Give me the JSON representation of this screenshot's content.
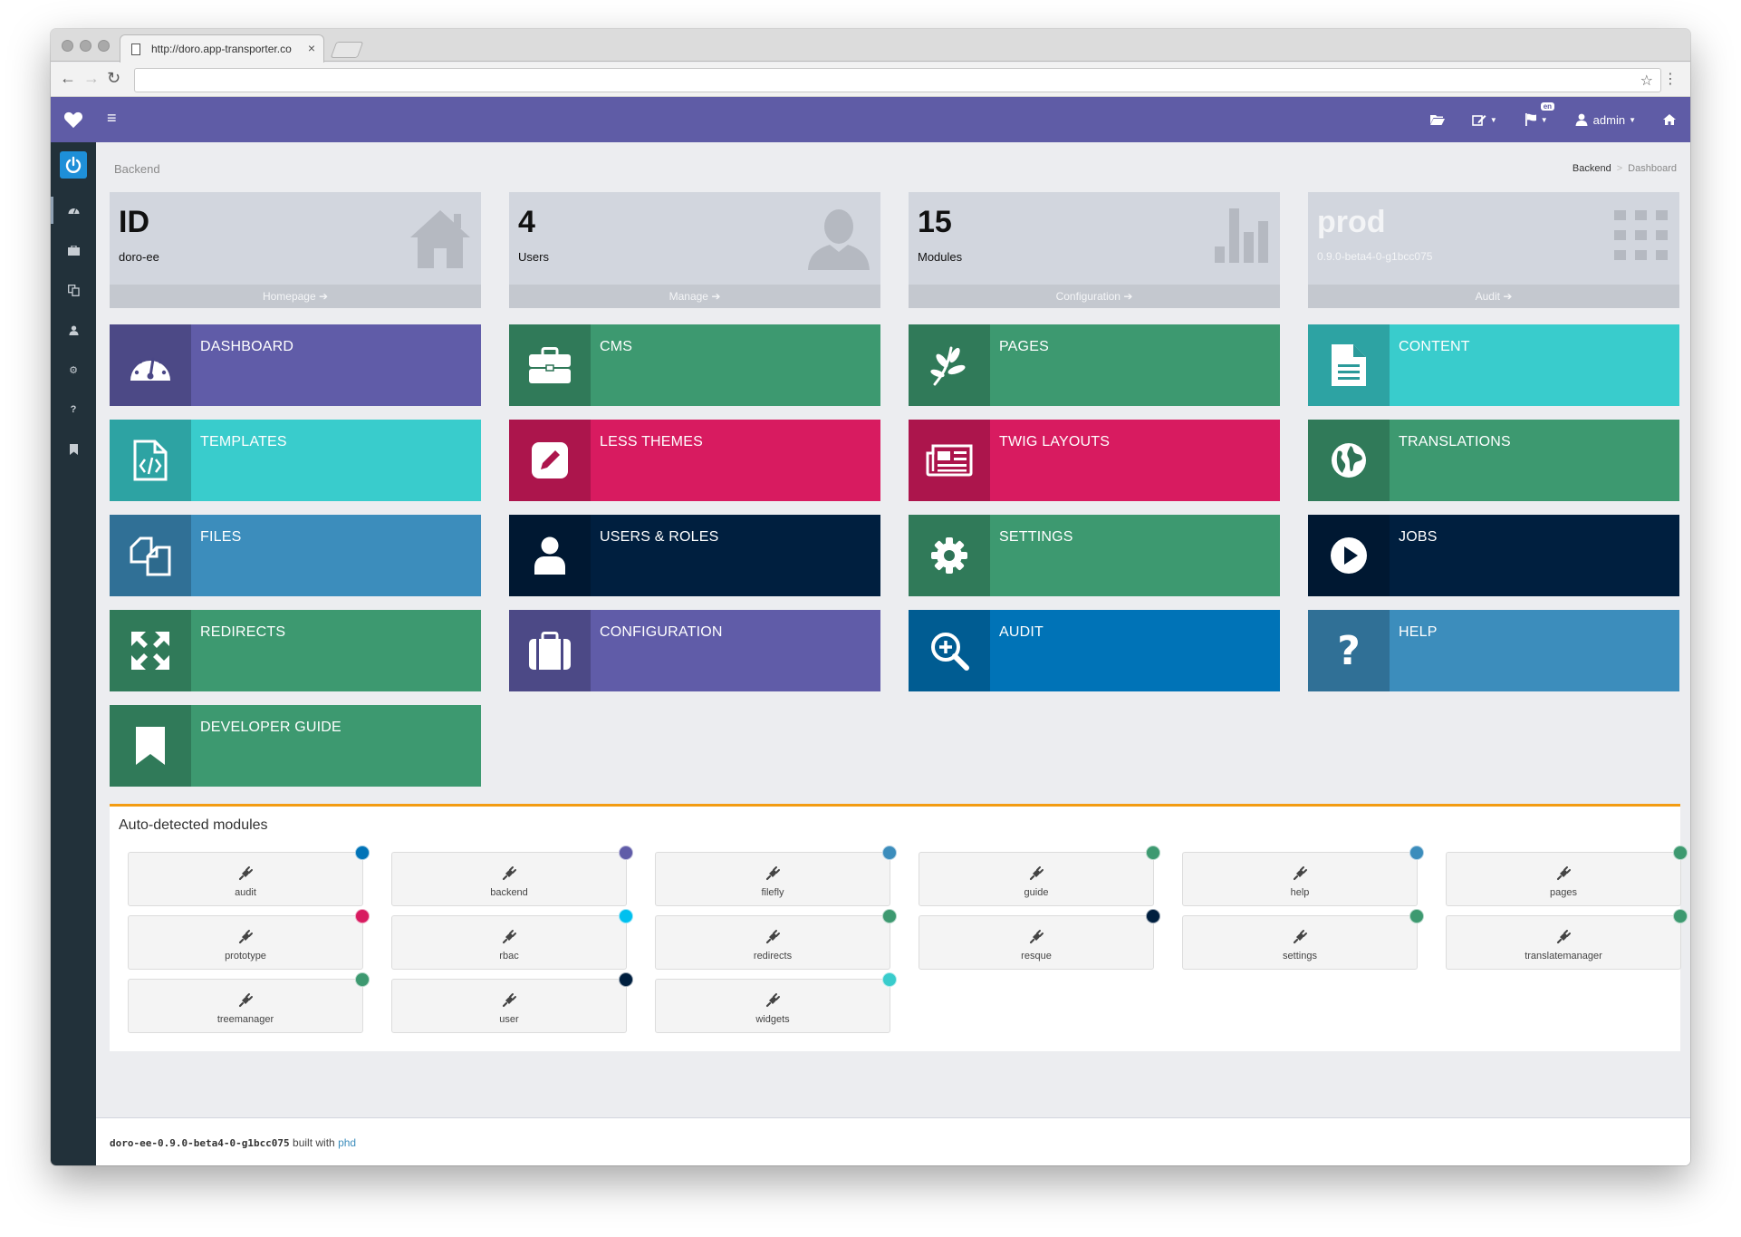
{
  "browser": {
    "tab_title": "http://doro.app-transporter.co",
    "tab_close": "×",
    "address": "",
    "back": "←",
    "forward": "→",
    "reload": "↻",
    "star": "☆",
    "menu": "⋮"
  },
  "topnav": {
    "brand_icon": "heart-icon",
    "toggle": "≡",
    "lang_badge": "en",
    "user_name": "admin",
    "caret": "▼"
  },
  "sidebar": {
    "items": [
      {
        "icon": "dashboard-icon"
      },
      {
        "icon": "briefcase-icon"
      },
      {
        "icon": "files-icon"
      },
      {
        "icon": "user-icon",
        "glyph": "●"
      },
      {
        "icon": "cogs-icon",
        "glyph": "⚙"
      },
      {
        "icon": "question-icon",
        "glyph": "?"
      },
      {
        "icon": "bookmark-icon"
      }
    ]
  },
  "page": {
    "title": "Backend",
    "breadcrumb": [
      "Backend",
      "Dashboard"
    ],
    "breadcrumb_sep": ">"
  },
  "stats": [
    {
      "value": "ID",
      "label": "doro-ee",
      "footer": "Homepage",
      "icon": "home-icon",
      "footer_icon": "➔"
    },
    {
      "value": "4",
      "label": "Users",
      "footer": "Manage",
      "icon": "user-icon",
      "footer_icon": "➔"
    },
    {
      "value": "15",
      "label": "Modules",
      "footer": "Configuration",
      "icon": "bar-chart-icon",
      "footer_icon": "➔"
    },
    {
      "value": "prod",
      "label": "0.9.0-beta4-0-g1bcc075",
      "footer": "Audit",
      "icon": "grid-icon",
      "footer_icon": "➔"
    }
  ],
  "tiles": [
    {
      "label": "DASHBOARD",
      "color": "#605ca8",
      "icon": "dashboard-icon"
    },
    {
      "label": "CMS",
      "color": "#3d9970",
      "icon": "briefcase-icon"
    },
    {
      "label": "PAGES",
      "color": "#3d9970",
      "icon": "leaf-icon"
    },
    {
      "label": "CONTENT",
      "color": "#39cccc",
      "icon": "file-text-icon"
    },
    {
      "label": "TEMPLATES",
      "color": "#39cccc",
      "icon": "file-code-icon"
    },
    {
      "label": "LESS THEMES",
      "color": "#d81b60",
      "icon": "pencil-square-icon"
    },
    {
      "label": "TWIG LAYOUTS",
      "color": "#d81b60",
      "icon": "newspaper-icon"
    },
    {
      "label": "TRANSLATIONS",
      "color": "#3d9970",
      "icon": "globe-icon"
    },
    {
      "label": "FILES",
      "color": "#3c8dbc",
      "icon": "files-icon"
    },
    {
      "label": "USERS & ROLES",
      "color": "#001f3f",
      "icon": "user-icon"
    },
    {
      "label": "SETTINGS",
      "color": "#3d9970",
      "icon": "gear-icon"
    },
    {
      "label": "JOBS",
      "color": "#001f3f",
      "icon": "play-circle-icon"
    },
    {
      "label": "REDIRECTS",
      "color": "#3d9970",
      "icon": "arrows-expand-icon"
    },
    {
      "label": "CONFIGURATION",
      "color": "#605ca8",
      "icon": "suitcase-icon"
    },
    {
      "label": "AUDIT",
      "color": "#0073b7",
      "icon": "search-plus-icon"
    },
    {
      "label": "HELP",
      "color": "#3c8dbc",
      "icon": "question-icon",
      "glyph": "?"
    },
    {
      "label": "DEVELOPER GUIDE",
      "color": "#3d9970",
      "icon": "bookmark-icon"
    }
  ],
  "modules": {
    "title": "Auto-detected modules",
    "items": [
      {
        "name": "audit",
        "color": "#0073b7"
      },
      {
        "name": "backend",
        "color": "#605ca8"
      },
      {
        "name": "filefly",
        "color": "#3c8dbc"
      },
      {
        "name": "guide",
        "color": "#3d9970"
      },
      {
        "name": "help",
        "color": "#3c8dbc"
      },
      {
        "name": "pages",
        "color": "#3d9970"
      },
      {
        "name": "prototype",
        "color": "#d81b60"
      },
      {
        "name": "rbac",
        "color": "#00c0ef"
      },
      {
        "name": "redirects",
        "color": "#3d9970"
      },
      {
        "name": "resque",
        "color": "#001f3f"
      },
      {
        "name": "settings",
        "color": "#3d9970"
      },
      {
        "name": "translatemanager",
        "color": "#3d9970"
      },
      {
        "name": "treemanager",
        "color": "#3d9970"
      },
      {
        "name": "user",
        "color": "#001f3f"
      },
      {
        "name": "widgets",
        "color": "#39cccc"
      }
    ]
  },
  "footer": {
    "version": "doro-ee-0.9.0-beta4-0-g1bcc075",
    "built_with": "built with",
    "link": "phd"
  }
}
